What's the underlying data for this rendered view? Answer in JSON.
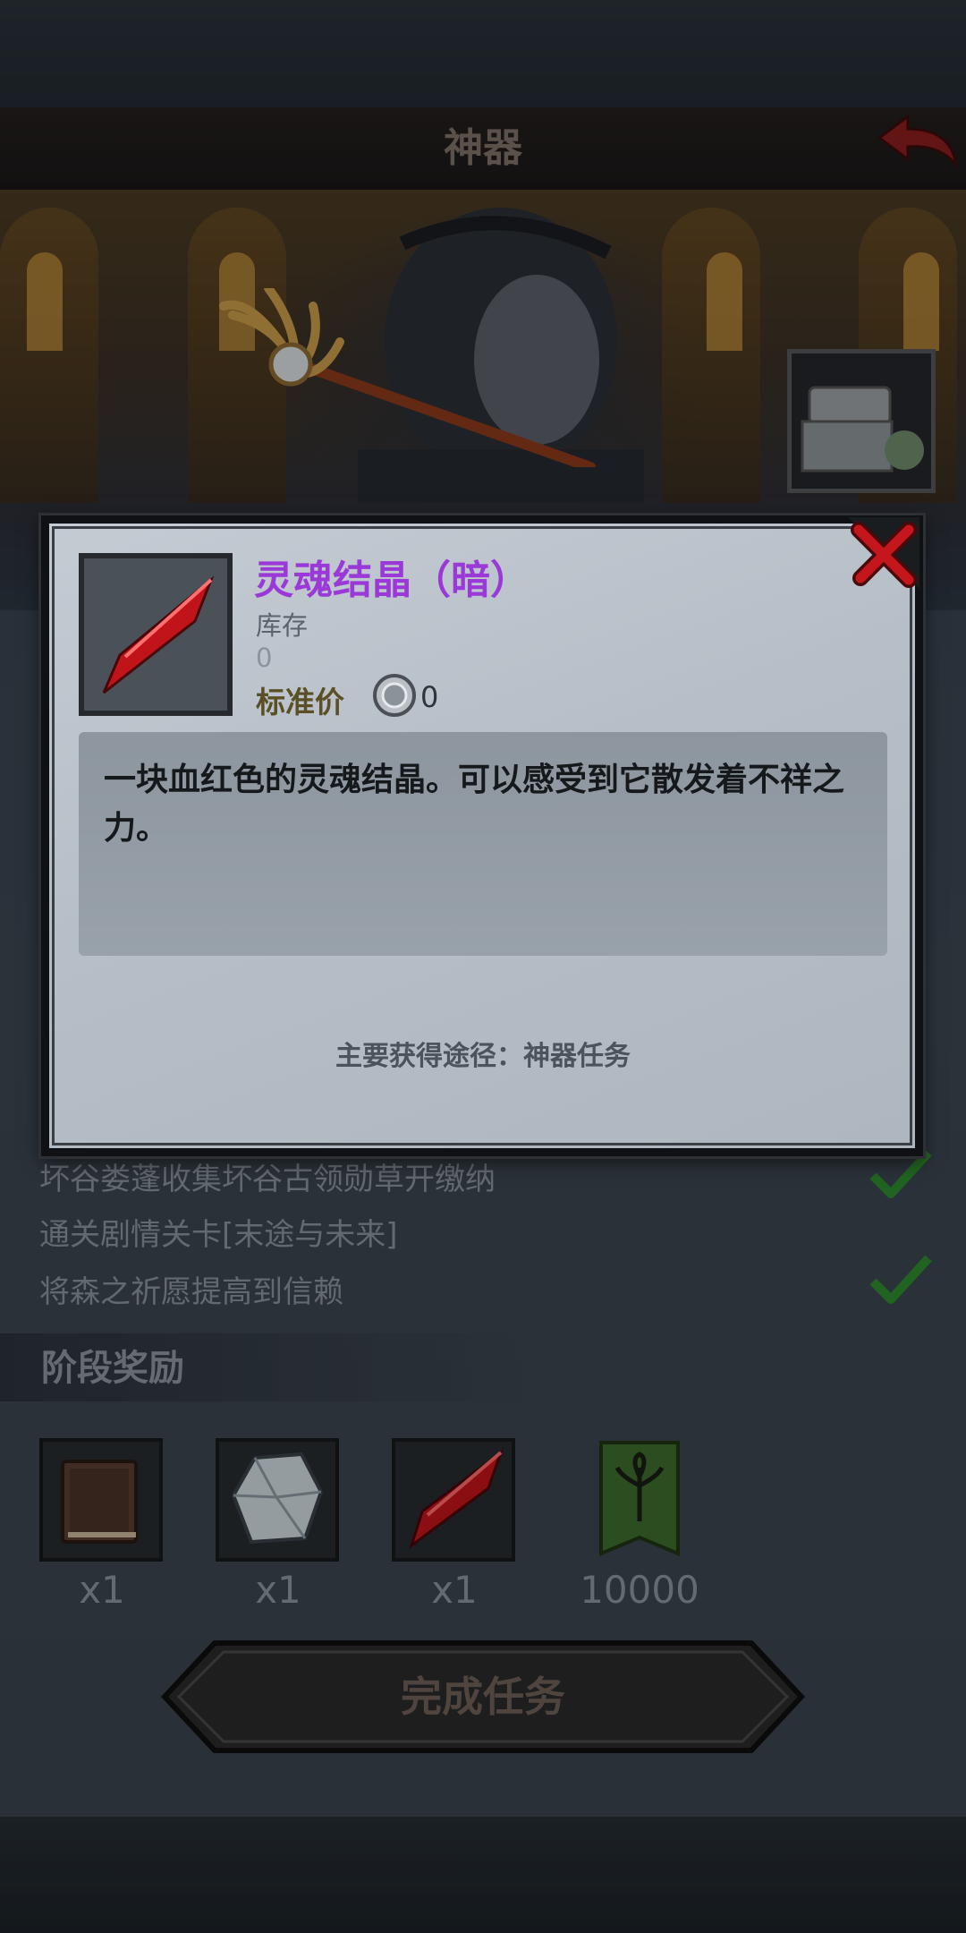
{
  "header": {
    "title": "神器"
  },
  "tasks": [
    {
      "text": "坏谷娄蓬收集坏谷古领勋草开缴纳",
      "done": true
    },
    {
      "text": "通关剧情关卡[末途与未来]",
      "done": false
    },
    {
      "text": "将森之祈愿提高到信赖",
      "done": true
    }
  ],
  "stage_rewards": {
    "title": "阶段奖励",
    "items": [
      {
        "icon": "book-icon",
        "count": "x1"
      },
      {
        "icon": "crystal-shard-icon",
        "count": "x1"
      },
      {
        "icon": "soul-crystal-dark-icon",
        "count": "x1"
      },
      {
        "icon": "forest-banner-icon",
        "count": "10000"
      }
    ]
  },
  "complete_button": {
    "label": "完成任务"
  },
  "popup": {
    "item_name": "灵魂结晶（暗）",
    "stock_label": "库存",
    "stock_value": "0",
    "price_label": "标准价",
    "price_value": "0",
    "description": "一块血红色的灵魂结晶。可以感受到它散发着不祥之力。",
    "source": "主要获得途径：神器任务",
    "close_icon": "close-x-icon",
    "item_icon": "soul-crystal-dark-icon"
  },
  "colors": {
    "item_name": "#9a39d8",
    "close_red": "#c4161c",
    "check_green": "#2e8b2e",
    "crystal_red": "#c0141a"
  }
}
